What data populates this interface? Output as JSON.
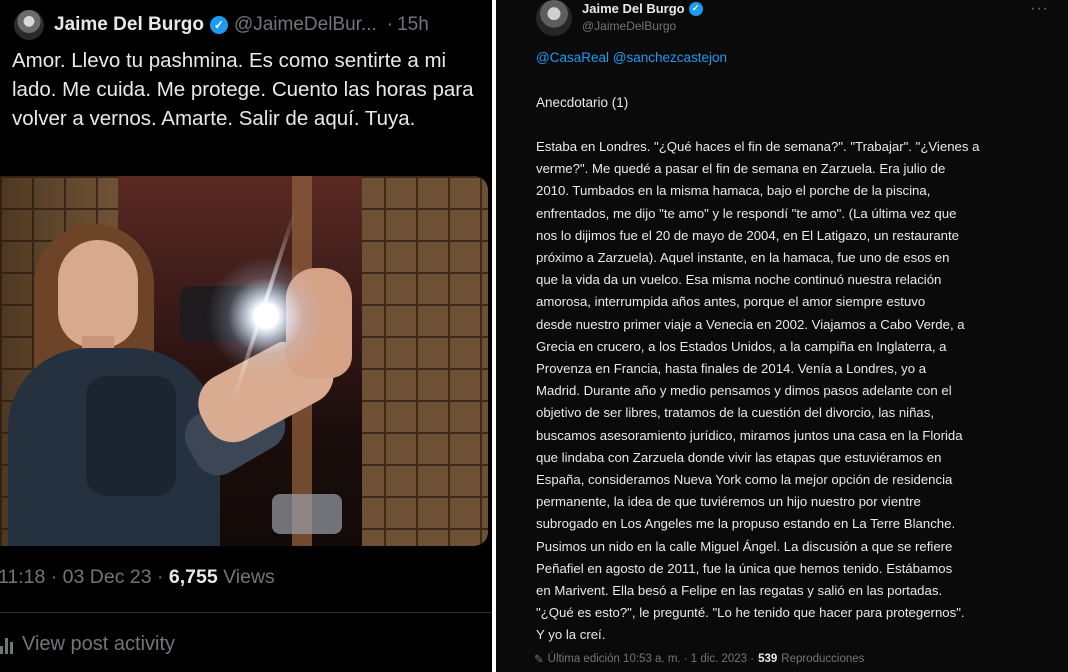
{
  "left_post": {
    "author_name": "Jaime Del Burgo",
    "author_handle": "@JaimeDelBur...",
    "time_separator": "·",
    "posted_ago": "15h",
    "text": "Amor. Llevo tu pashmina. Es como sentirte a mi lado. Me cuida. Me protege. Cuento las horas para volver a vernos. Amarte. Salir de aquí. Tuya.",
    "meta_datetime": "11:18 · 03 Dec 23 · ",
    "views_count": "6,755",
    "views_label": " Views",
    "activity_label": "View post activity"
  },
  "right_post": {
    "author_name": "Jaime Del Burgo",
    "author_handle": "@JaimeDelBurgo",
    "more_menu": "···",
    "mentions": "@CasaReal @sanchezcastejon",
    "heading": "Anecdotario (1)",
    "body_lines": [
      "Estaba en Londres. \"¿Qué haces el fin de semana?\". \"Trabajar\". \"¿Vienes a",
      "verme?\". Me quedé a pasar el fin de semana en Zarzuela. Era julio de",
      "2010. Tumbados en la misma hamaca, bajo el porche de la piscina,",
      "enfrentados, me dijo \"te amo\" y le respondí \"te amo\". (La última vez que",
      "nos lo dijimos fue el 20 de mayo de 2004, en El Latigazo, un restaurante",
      "próximo a Zarzuela). Aquel instante, en la hamaca, fue uno de esos en",
      "que la vida da un vuelco. Esa misma noche continuó nuestra relación",
      "amorosa, interrumpida años antes, porque el amor siempre estuvo",
      "desde nuestro primer viaje a Venecia en 2002. Viajamos a Cabo Verde, a",
      "Grecia en crucero, a los Estados Unidos, a la campiña en Inglaterra, a",
      "Provenza en Francia, hasta finales de 2014. Venía a Londres, yo a",
      "Madrid. Durante año y medio pensamos y dimos pasos adelante con el",
      "objetivo de ser libres, tratamos de la cuestión del divorcio, las niñas,",
      "buscamos asesoramiento jurídico, miramos juntos una casa en la Florida",
      "que lindaba con Zarzuela donde vivir las etapas que estuviéramos en",
      "España, consideramos Nueva York como la mejor opción de residencia",
      "permanente, la idea de que tuviéremos un hijo nuestro por vientre",
      "subrogado en Los Angeles me la propuso estando en La Terre Blanche.",
      "Pusimos un nido en la calle Miguel Ángel. La discusión a que se refiere",
      "Peñafiel en agosto de 2011, fue la única que hemos tenido. Estábamos",
      "en Marivent. Ella besó a Felipe en las regatas y salió en las portadas.",
      "\"¿Qué es esto?\", le pregunté. \"Lo he tenido que hacer para protegernos\".",
      "Y yo la creí."
    ],
    "footer_edit": "Última edición 10:53 a. m. · 1 dic. 2023 ·",
    "footer_views_count": "539",
    "footer_views_label": "Reproducciones"
  },
  "icons": {
    "verified": "verified-badge-icon",
    "more": "more-dots-icon",
    "activity": "bar-chart-icon",
    "edit": "pencil-icon"
  },
  "colors": {
    "accent_blue": "#1d9bf0",
    "muted_text": "#71767b",
    "primary_text": "#e7e9ea",
    "background": "#000000"
  }
}
